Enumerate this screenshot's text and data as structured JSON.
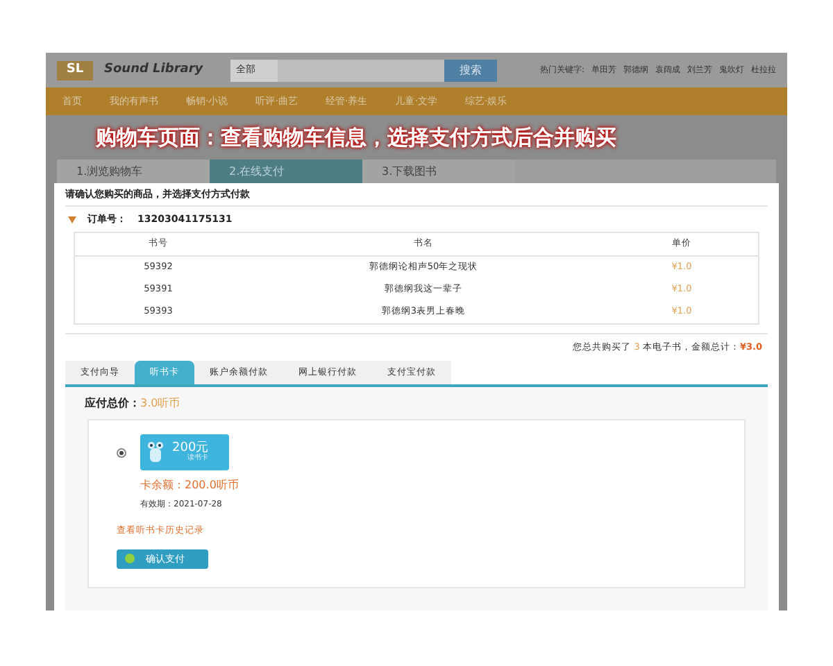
{
  "header": {
    "logo": "SL",
    "site_name": "Sound Library",
    "search_scope": "全部",
    "search_button": "搜索",
    "hot_label": "热门关键字:",
    "hot_keywords": [
      "单田芳",
      "郭德纲",
      "袁阔成",
      "刘兰芳",
      "鬼吹灯",
      "杜拉拉"
    ]
  },
  "nav": [
    {
      "label": "首页"
    },
    {
      "label": "我的有声书"
    },
    {
      "label": "畅销·小说"
    },
    {
      "label": "听评·曲艺"
    },
    {
      "label": "经管·养生"
    },
    {
      "label": "儿童·文学"
    },
    {
      "label": "综艺·娱乐"
    }
  ],
  "caption": "购物车页面：查看购物车信息，选择支付方式后合并购买",
  "steps": [
    {
      "label": "1.浏览购物车",
      "selected": false
    },
    {
      "label": "2.在线支付",
      "selected": true
    },
    {
      "label": "3.下载图书",
      "selected": false
    }
  ],
  "instruction": "请确认您购买的商品，并选择支付方式付款",
  "order": {
    "label": "订单号：",
    "number": "13203041175131"
  },
  "table": {
    "columns": [
      "书号",
      "书名",
      "单价"
    ],
    "rows": [
      [
        "59392",
        "郭德纲论相声50年之现状",
        "¥1.0"
      ],
      [
        "59391",
        "郭德纲我这一辈子",
        "¥1.0"
      ],
      [
        "59393",
        "郭德纲3表男上春晚",
        "¥1.0"
      ]
    ]
  },
  "summary": {
    "prefix": "您总共购买了",
    "count": "3",
    "middle": "本电子书，金额总计：",
    "total": "¥3.0"
  },
  "payment_tabs": [
    {
      "label": "支付向导",
      "selected": false
    },
    {
      "label": "听书卡",
      "selected": true
    },
    {
      "label": "账户余额付款",
      "selected": false
    },
    {
      "label": "网上银行付款",
      "selected": false
    },
    {
      "label": "支付宝付款",
      "selected": false
    }
  ],
  "due": {
    "label": "应付总价：",
    "value": "3.0听币"
  },
  "card": {
    "selected": true,
    "amount": "200元",
    "card_name": "读书卡",
    "balance": "卡余额：200.0听币",
    "expiry": "有效期：2021-07-28"
  },
  "history_link": "查看听书卡历史记录",
  "confirm_button": "确认支付"
}
